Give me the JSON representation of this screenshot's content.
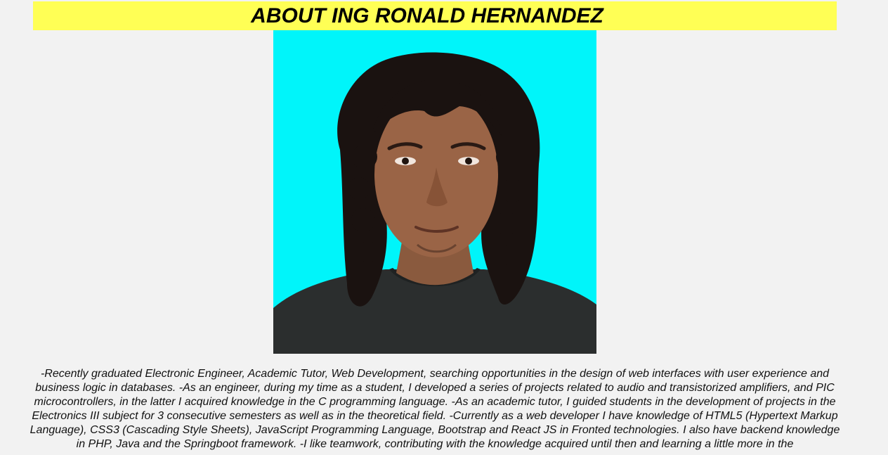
{
  "header": {
    "title": "ABOUT ING RONALD HERNANDEZ"
  },
  "colors": {
    "page_background": "#f2f2f2",
    "title_background": "#ffff55",
    "photo_background": "#00f5fa"
  },
  "profile": {
    "photo_icon": "portrait-photo",
    "bio": "-Recently graduated Electronic Engineer, Academic Tutor, Web Development, searching opportunities in the design of web interfaces with user experience and business logic in databases. -As an engineer, during my time as a student, I developed a series of projects related to audio and transistorized amplifiers, and PIC microcontrollers, in the latter I acquired knowledge in the C programming language. -As an academic tutor, I guided students in the development of projects in the Electronics III subject for 3 consecutive semesters as well as in the theoretical field. -Currently as a web developer I have knowledge of HTML5 (Hypertext Markup Language), CSS3 (Cascading Style Sheets), JavaScript Programming Language, Bootstrap and React JS in Fronted technologies. I also have backend knowledge in PHP, Java and the Springboot framework. -I like teamwork, contributing with the knowledge acquired until then and learning a little more in the"
  }
}
